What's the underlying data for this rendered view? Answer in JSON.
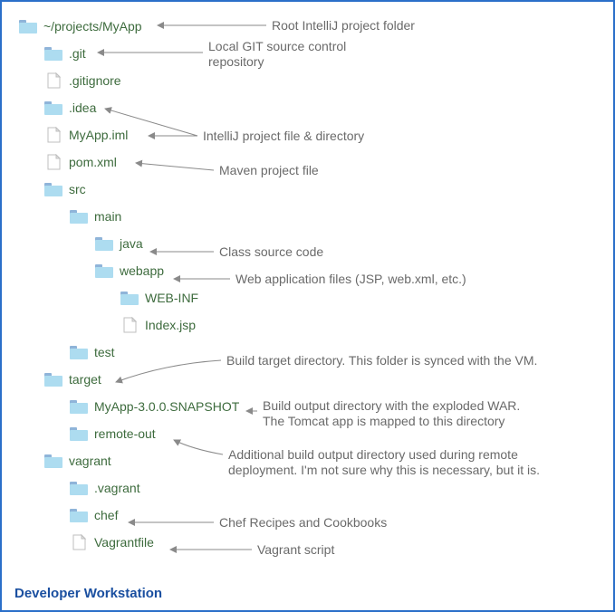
{
  "caption": "Developer Workstation",
  "tree": {
    "root": {
      "name": "~/projects/MyApp",
      "type": "folder"
    },
    "git": {
      "name": ".git",
      "type": "folder"
    },
    "gitignore": {
      "name": ".gitignore",
      "type": "file"
    },
    "idea": {
      "name": ".idea",
      "type": "folder"
    },
    "myapp_iml": {
      "name": "MyApp.iml",
      "type": "file"
    },
    "pom": {
      "name": "pom.xml",
      "type": "file"
    },
    "src": {
      "name": "src",
      "type": "folder"
    },
    "main": {
      "name": "main",
      "type": "folder"
    },
    "java": {
      "name": "java",
      "type": "folder"
    },
    "webapp": {
      "name": "webapp",
      "type": "folder"
    },
    "webinf": {
      "name": "WEB-INF",
      "type": "folder"
    },
    "indexjsp": {
      "name": "Index.jsp",
      "type": "file"
    },
    "test": {
      "name": "test",
      "type": "folder"
    },
    "target": {
      "name": "target",
      "type": "folder"
    },
    "snapshot": {
      "name": "MyApp-3.0.0.SNAPSHOT",
      "type": "folder"
    },
    "remoteout": {
      "name": "remote-out",
      "type": "folder"
    },
    "vagrant": {
      "name": "vagrant",
      "type": "folder"
    },
    "dotvagrant": {
      "name": ".vagrant",
      "type": "folder"
    },
    "chef": {
      "name": "chef",
      "type": "folder"
    },
    "vagrantfile": {
      "name": "Vagrantfile",
      "type": "file"
    }
  },
  "annotations": {
    "root": "Root IntelliJ project folder",
    "git_line1": "Local GIT source control",
    "git_line2": "repository",
    "idea": "IntelliJ project file & directory",
    "pom": "Maven project file",
    "java": "Class source code",
    "webapp": "Web application files (JSP, web.xml, etc.)",
    "target": "Build target directory. This folder is synced with the VM.",
    "snapshot_line1": "Build output directory with the exploded WAR.",
    "snapshot_line2": "The Tomcat app is mapped to this directory",
    "remoteout_line1": "Additional build output directory used during remote",
    "remoteout_line2": "deployment. I'm not sure why this is necessary, but it is.",
    "chef": "Chef Recipes and Cookbooks",
    "vagrantfile": "Vagrant script"
  }
}
